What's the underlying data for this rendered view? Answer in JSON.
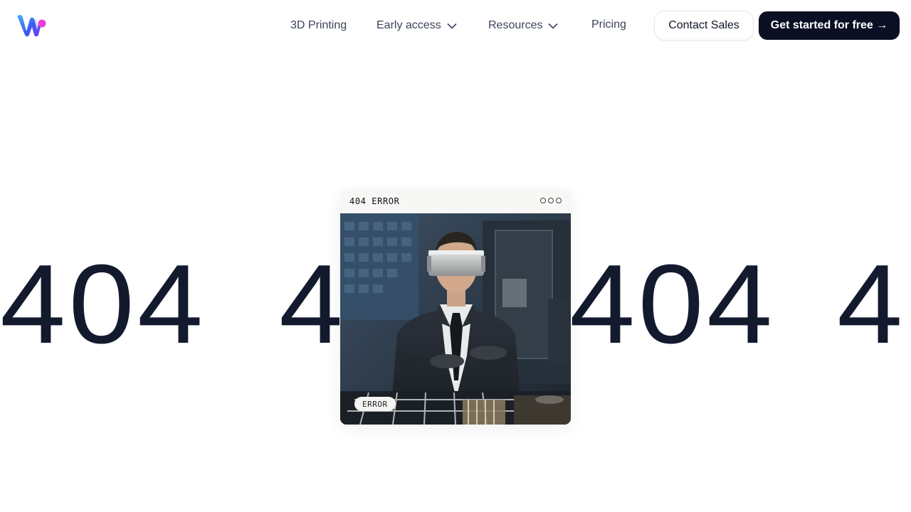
{
  "header": {
    "logo_icon": "w-logo-icon",
    "nav": [
      {
        "label": "3D Printing",
        "has_dropdown": false
      },
      {
        "label": "Early access",
        "has_dropdown": true
      },
      {
        "label": "Resources",
        "has_dropdown": true
      },
      {
        "label": "Pricing",
        "has_dropdown": false
      }
    ],
    "contact_label": "Contact Sales",
    "start_label": "Get started for free →"
  },
  "hero": {
    "big_text": [
      "404",
      "4",
      "404",
      "4"
    ]
  },
  "card": {
    "title": "404 ERROR",
    "badge": "ERROR",
    "image_alt": "man-wearing-vr-headset-gif"
  },
  "colors": {
    "primary_dark": "#0b0f23",
    "big_text": "#141a2e",
    "nav_text": "#3b4459"
  }
}
